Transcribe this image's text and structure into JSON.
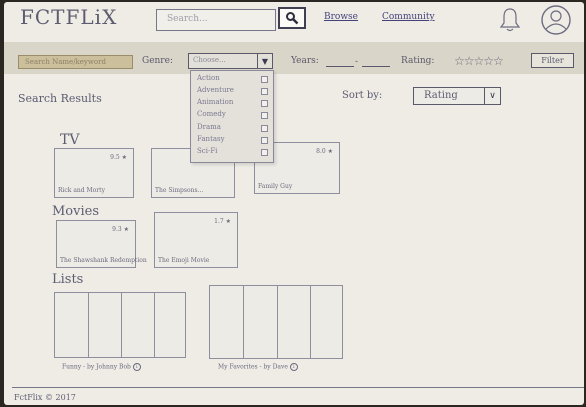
{
  "header": {
    "logo": "FCTFLiX",
    "search_placeholder": "Search...",
    "nav": {
      "browse": "Browse",
      "community": "Community"
    },
    "icons": {
      "search": "search-icon",
      "notifications": "bell-icon",
      "profile": "avatar-icon"
    }
  },
  "filters": {
    "search_value": "Search Name/keyword",
    "genre_label": "Genre:",
    "genre_value": "Choose...",
    "years_label": "Years:",
    "years_separator": "-",
    "rating_label": "Rating:",
    "rating_stars": "☆☆☆☆☆",
    "filter_button": "Filter"
  },
  "genre_dropdown": {
    "options": [
      "Action",
      "Adventure",
      "Animation",
      "Comedy",
      "Drama",
      "Fantasy",
      "Sci-Fi"
    ]
  },
  "results": {
    "title": "Search Results",
    "sort_label": "Sort by:",
    "sort_value": "Rating"
  },
  "sections": {
    "tv": {
      "label": "TV",
      "items": [
        {
          "title": "Rick and Morty",
          "rating": "9.5 ★"
        },
        {
          "title": "The Simpsons...",
          "rating": ""
        },
        {
          "title": "Family Guy",
          "rating": "8.0 ★"
        }
      ]
    },
    "movies": {
      "label": "Movies",
      "items": [
        {
          "title": "The Shawshank Redemption",
          "rating": "9.3 ★"
        },
        {
          "title": "The Emoji Movie",
          "rating": "1.7 ★"
        }
      ]
    },
    "lists": {
      "label": "Lists",
      "items": [
        {
          "caption": "Funny - by Johnny Bob"
        },
        {
          "caption": "My Favorites - by Dave"
        }
      ]
    }
  },
  "footer": {
    "text": "FctFlix © 2017"
  }
}
